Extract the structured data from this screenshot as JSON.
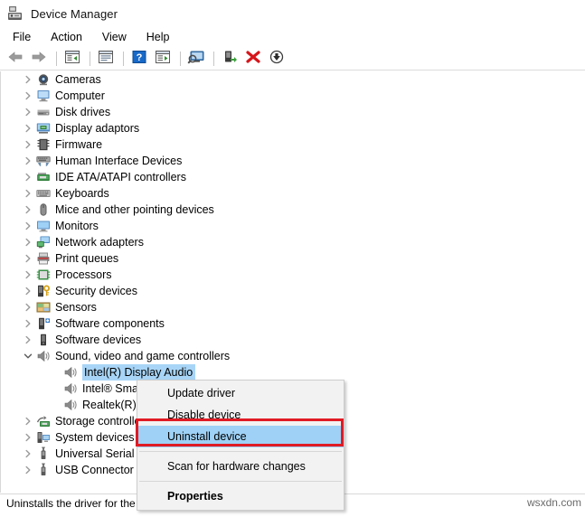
{
  "window": {
    "title": "Device Manager",
    "app_icon": "device-manager-icon"
  },
  "menubar": {
    "items": [
      {
        "label": "File",
        "name": "menu-file"
      },
      {
        "label": "Action",
        "name": "menu-action"
      },
      {
        "label": "View",
        "name": "menu-view"
      },
      {
        "label": "Help",
        "name": "menu-help"
      }
    ]
  },
  "toolbar": {
    "buttons": [
      {
        "icon": "back-arrow-icon",
        "name": "toolbar-back"
      },
      {
        "icon": "forward-arrow-icon",
        "name": "toolbar-forward"
      },
      {
        "icon": "show-hide-console-tree-icon",
        "name": "toolbar-console-tree"
      },
      {
        "icon": "properties-icon",
        "name": "toolbar-properties"
      },
      {
        "icon": "help-icon",
        "name": "toolbar-help"
      },
      {
        "icon": "update-driver-icon",
        "name": "toolbar-update-driver"
      },
      {
        "icon": "scan-hardware-changes-icon",
        "name": "toolbar-scan-hardware"
      },
      {
        "icon": "enable-device-icon",
        "name": "toolbar-enable-device"
      },
      {
        "icon": "uninstall-device-icon",
        "name": "toolbar-uninstall-device"
      },
      {
        "icon": "disable-device-icon",
        "name": "toolbar-disable-device"
      }
    ]
  },
  "tree": {
    "nodes": [
      {
        "label": "Cameras",
        "icon": "camera-icon",
        "depth": 1,
        "expanded": false,
        "selected": false
      },
      {
        "label": "Computer",
        "icon": "computer-icon",
        "depth": 1,
        "expanded": false,
        "selected": false
      },
      {
        "label": "Disk drives",
        "icon": "disk-drive-icon",
        "depth": 1,
        "expanded": false,
        "selected": false
      },
      {
        "label": "Display adaptors",
        "icon": "display-adapter-icon",
        "depth": 1,
        "expanded": false,
        "selected": false
      },
      {
        "label": "Firmware",
        "icon": "firmware-chip-icon",
        "depth": 1,
        "expanded": false,
        "selected": false
      },
      {
        "label": "Human Interface Devices",
        "icon": "hid-icon",
        "depth": 1,
        "expanded": false,
        "selected": false
      },
      {
        "label": "IDE ATA/ATAPI controllers",
        "icon": "ide-controller-icon",
        "depth": 1,
        "expanded": false,
        "selected": false
      },
      {
        "label": "Keyboards",
        "icon": "keyboard-icon",
        "depth": 1,
        "expanded": false,
        "selected": false
      },
      {
        "label": "Mice and other pointing devices",
        "icon": "mouse-icon",
        "depth": 1,
        "expanded": false,
        "selected": false
      },
      {
        "label": "Monitors",
        "icon": "monitor-icon",
        "depth": 1,
        "expanded": false,
        "selected": false
      },
      {
        "label": "Network adapters",
        "icon": "network-adapter-icon",
        "depth": 1,
        "expanded": false,
        "selected": false
      },
      {
        "label": "Print queues",
        "icon": "printer-icon",
        "depth": 1,
        "expanded": false,
        "selected": false
      },
      {
        "label": "Processors",
        "icon": "processor-icon",
        "depth": 1,
        "expanded": false,
        "selected": false
      },
      {
        "label": "Security devices",
        "icon": "security-key-icon",
        "depth": 1,
        "expanded": false,
        "selected": false
      },
      {
        "label": "Sensors",
        "icon": "sensor-icon",
        "depth": 1,
        "expanded": false,
        "selected": false
      },
      {
        "label": "Software components",
        "icon": "software-component-icon",
        "depth": 1,
        "expanded": false,
        "selected": false
      },
      {
        "label": "Software devices",
        "icon": "software-device-icon",
        "depth": 1,
        "expanded": false,
        "selected": false
      },
      {
        "label": "Sound, video and game controllers",
        "icon": "speaker-icon",
        "depth": 1,
        "expanded": true,
        "selected": false
      },
      {
        "label": "Intel(R) Display Audio",
        "icon": "speaker-icon",
        "depth": 2,
        "expanded": null,
        "selected": true
      },
      {
        "label": "Intel® Smart Sound Technology",
        "icon": "speaker-icon",
        "depth": 2,
        "expanded": null,
        "selected": false
      },
      {
        "label": "Realtek(R) Audio",
        "icon": "speaker-icon",
        "depth": 2,
        "expanded": null,
        "selected": false
      },
      {
        "label": "Storage controllers",
        "icon": "storage-controller-icon",
        "depth": 1,
        "expanded": false,
        "selected": false
      },
      {
        "label": "System devices",
        "icon": "system-device-icon",
        "depth": 1,
        "expanded": false,
        "selected": false
      },
      {
        "label": "Universal Serial Bus controllers",
        "icon": "usb-icon",
        "depth": 1,
        "expanded": false,
        "selected": false
      },
      {
        "label": "USB Connector Managers",
        "icon": "usb-icon",
        "depth": 1,
        "expanded": false,
        "selected": false
      }
    ]
  },
  "context_menu": {
    "items": [
      {
        "label": "Update driver",
        "highlighted": false,
        "bold": false,
        "separator_after": false
      },
      {
        "label": "Disable device",
        "highlighted": false,
        "bold": false,
        "separator_after": false
      },
      {
        "label": "Uninstall device",
        "highlighted": true,
        "bold": false,
        "separator_after": true
      },
      {
        "label": "Scan for hardware changes",
        "highlighted": false,
        "bold": false,
        "separator_after": true
      },
      {
        "label": "Properties",
        "highlighted": false,
        "bold": true,
        "separator_after": false
      }
    ]
  },
  "annotation": {
    "highlight_color": "#e01b24",
    "target": "Uninstall device"
  },
  "statusbar": {
    "text": "Uninstalls the driver for the selected device."
  },
  "watermark": {
    "text": "wsxdn.com"
  },
  "colors": {
    "selection_blue": "#a8d5f7",
    "menu_highlight": "#9ed1f5",
    "annotation_red": "#e01b24",
    "window_bg": "#ffffff",
    "menu_bg": "#f2f2f2"
  }
}
